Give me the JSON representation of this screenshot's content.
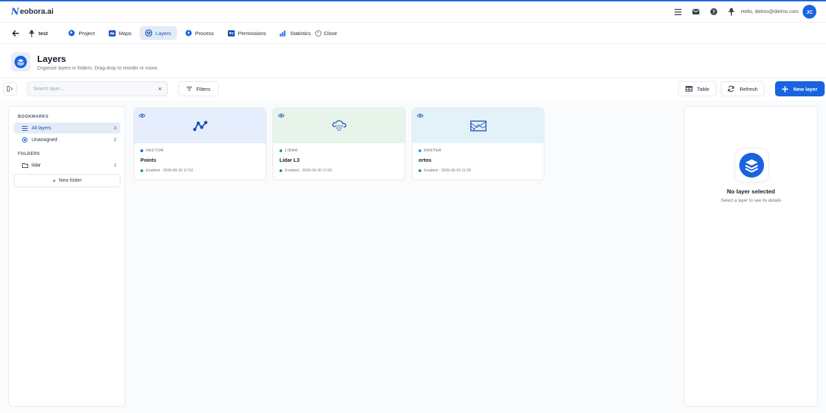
{
  "brand": {
    "logo_mark": "N",
    "logo_text": "eobora.ai",
    "accent_color": "#1a63e0"
  },
  "header": {
    "icons": [
      "menu-icon",
      "mail-icon",
      "help-icon",
      "drone-icon"
    ],
    "greeting": "Hello, dielmo@dielmo.com",
    "avatar_initials": "JC"
  },
  "project_nav": {
    "project_name": "test",
    "tabs": [
      {
        "label": "Project",
        "icon": "globe-icon",
        "active": false
      },
      {
        "label": "Maps",
        "icon": "map-icon",
        "active": false
      },
      {
        "label": "Layers",
        "icon": "layers-icon",
        "active": true
      },
      {
        "label": "Process",
        "icon": "process-icon",
        "active": false
      },
      {
        "label": "Permissions",
        "icon": "id-card-icon",
        "active": false
      },
      {
        "label": "Statistics",
        "icon": "chart-icon",
        "active": false
      }
    ],
    "close_label": "Close"
  },
  "page": {
    "title": "Layers",
    "subtitle": "Organize layers in folders. Drag-drop to reorder or move."
  },
  "toolbar": {
    "search_placeholder": "Search layer...",
    "filters_label": "Filters",
    "table_label": "Table",
    "refresh_label": "Refresh",
    "new_layer_label": "New layer"
  },
  "sidebar": {
    "bookmarks_title": "BOOKMARKS",
    "bookmarks": [
      {
        "label": "All layers",
        "count": "3",
        "icon": "list-icon",
        "active": true
      },
      {
        "label": "Unassigned",
        "count": "2",
        "icon": "target-icon",
        "active": false
      }
    ],
    "folders_title": "FOLDERS",
    "folders": [
      {
        "label": "lidar",
        "count": "1",
        "icon": "folder-icon"
      }
    ],
    "new_folder_label": "New folder"
  },
  "layers": [
    {
      "type": "VECTOR",
      "name": "Points",
      "status": "Enabled · 2026-06-30 17:52",
      "icon": "vector-icon",
      "bg_color": "#e6edfc",
      "type_color": "#1a63e0",
      "status_color": "#16a34a"
    },
    {
      "type": "LIDAR",
      "name": "Lidar L3",
      "status": "Enabled · 2026-06-30 17:52",
      "icon": "lidar-cloud-icon",
      "bg_color": "#e6f4ea",
      "type_color": "#16a34a",
      "status_color": "#16a34a"
    },
    {
      "type": "RASTER",
      "name": "ortos",
      "status": "Enabled · 2026-06-03 11:29",
      "icon": "raster-image-icon",
      "bg_color": "#e3f2f9",
      "type_color": "#0ea5e9",
      "status_color": "#16a34a"
    }
  ],
  "detail": {
    "empty_title": "No layer selected",
    "empty_subtitle": "Select a layer to see its details"
  }
}
